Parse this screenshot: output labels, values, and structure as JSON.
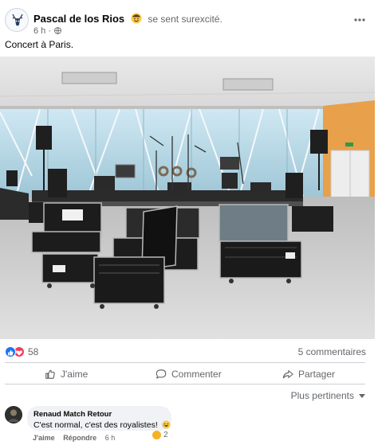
{
  "post": {
    "author": "Pascal de los Rios",
    "feeling": "se sent surexcité.",
    "time": "6 h",
    "time_sep": "·",
    "text": "Concert à Paris."
  },
  "reactions": {
    "count": "58",
    "comments": "5 commentaires",
    "types": [
      "like",
      "love"
    ],
    "colors": {
      "like": "#1877f2",
      "love": "#f33e58"
    }
  },
  "actions": {
    "like": "J'aime",
    "comment": "Commenter",
    "share": "Partager"
  },
  "comments_sort": "Plus pertinents",
  "comment": {
    "author": "Renaud Match Retour",
    "text": "C'est normal, c'est des royalistes!",
    "like": "J'aime",
    "reply": "Répondre",
    "time": "6 h",
    "reaction_count": "2"
  },
  "icons": {
    "avatar": "deer-head-logo",
    "feeling": "excited-face-emoji",
    "privacy": "globe-icon",
    "more": "more-icon"
  },
  "colors": {
    "accent": "#1877f2",
    "secondary_text": "#65676b",
    "bubble": "#f0f2f5"
  }
}
